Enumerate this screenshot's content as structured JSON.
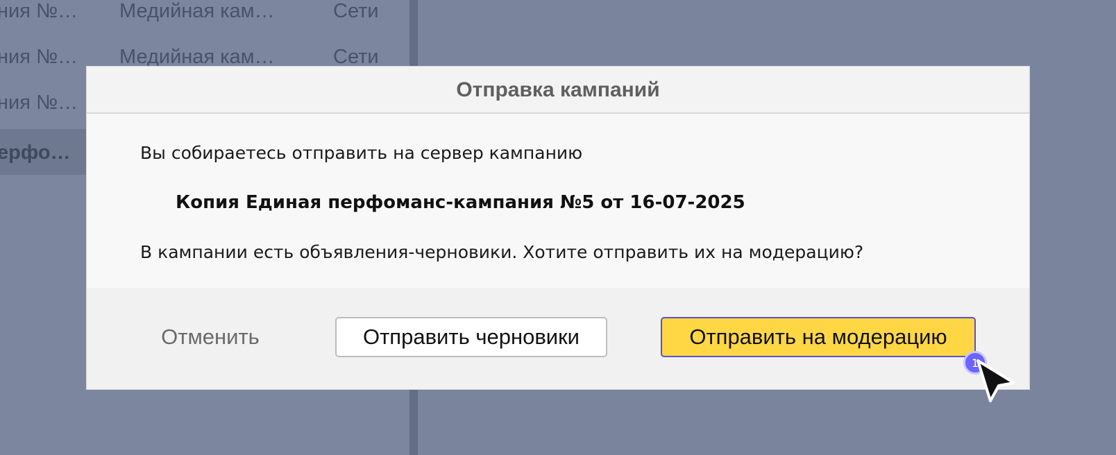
{
  "background": {
    "rows": [
      {
        "col1": "ния №…",
        "col2": "Медийная кам…",
        "col3": "Сети"
      },
      {
        "col1": "ния №…",
        "col2": "Медийная кам…",
        "col3": "Сети"
      },
      {
        "col1": "ния №…",
        "col2": "",
        "col3": ""
      },
      {
        "col1": "ерфо…",
        "col2": "",
        "col3": ""
      }
    ]
  },
  "dialog": {
    "title": "Отправка кампаний",
    "intro": "Вы собираетесь отправить на сервер кампанию",
    "campaign_name": "Копия Единая перфоманс-кампания №5 от 16-07-2025",
    "question": "В кампании есть объявления-черновики. Хотите отправить их на модерацию?",
    "buttons": {
      "cancel": "Отменить",
      "send_drafts": "Отправить черновики",
      "send_moderation": "Отправить на модерацию"
    }
  },
  "cursor": {
    "click_count": "1",
    "icon": "pointer-arrow-icon"
  },
  "colors": {
    "primary_button": "#ffd744",
    "overlay": "#78839c"
  }
}
